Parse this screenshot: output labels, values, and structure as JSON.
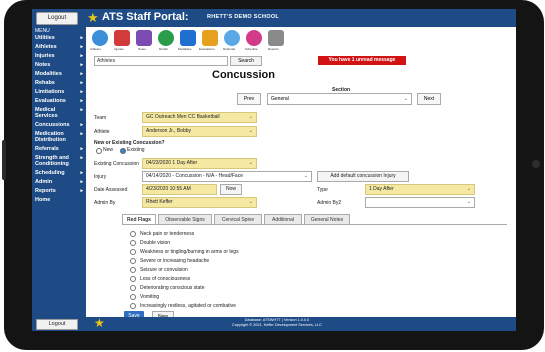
{
  "header": {
    "logout_label": "Logout",
    "portal_title": "ATS Staff Portal:",
    "school_name": "RHETT'S DEMO SCHOOL"
  },
  "sidebar": {
    "menu_heading": "MENU",
    "items": [
      {
        "label": "Utilities"
      },
      {
        "label": "Athletes"
      },
      {
        "label": "Injuries"
      },
      {
        "label": "Notes"
      },
      {
        "label": "Modalities"
      },
      {
        "label": "Rehabs"
      },
      {
        "label": "Limitations"
      },
      {
        "label": "Evaluations"
      },
      {
        "label": "Medical\nServices"
      },
      {
        "label": "Concussions"
      },
      {
        "label": "Medication\nDistribution"
      },
      {
        "label": "Referrals"
      },
      {
        "label": "Strength and\nConditioning"
      },
      {
        "label": "Scheduling"
      },
      {
        "label": "Admin"
      },
      {
        "label": "Reports"
      },
      {
        "label": "Home"
      }
    ]
  },
  "filter": {
    "athletes_select": "Athletes",
    "search_label": "Search",
    "unread_message": "You have 1 unread message"
  },
  "page": {
    "title": "Concussion",
    "section_label": "Section",
    "prev_label": "Prev",
    "section_value": "General",
    "next_label": "Next"
  },
  "form": {
    "team_label": "Team",
    "team_value": "GC Outreach Men CC Basketball",
    "athlete_label": "Athlete",
    "athlete_value": "Anderson Jr., Bobby",
    "new_existing_label": "New or Existing Concussion?",
    "new_option": "New",
    "existing_option": "Existing",
    "existing_concussion_label": "Existing Concussion",
    "existing_concussion_value": "04/23/2020 1 Day After",
    "injury_label": "Injury",
    "injury_value": "04/14/2020 - Concussion - N/A - Head/Face",
    "add_default_label": "Add default concussion Injury",
    "date_assessed_label": "Date Assessed",
    "date_assessed_value": "4/23/2020 10:55 AM",
    "now_label": "Now",
    "type_label": "Type",
    "type_value": "1 Day After",
    "admin_by_label": "Admin By",
    "admin_by_value": "Rhett Keffer",
    "admin_by2_label": "Admin By2",
    "admin_by2_value": ""
  },
  "tabs": [
    {
      "label": "Red Flags"
    },
    {
      "label": "Observable Signs"
    },
    {
      "label": "Cervical Spine"
    },
    {
      "label": "Additional"
    },
    {
      "label": "General Notes"
    }
  ],
  "red_flags": [
    "Neck pain or tenderness",
    "Double vision",
    "Weakness or tingling/burning in arms or legs",
    "Severe or increasing headache",
    "Seizure or convulsion",
    "Loss of consciousness",
    "Deteriorating conscious state",
    "Vomiting",
    "Increasingly restless, agitated or combative"
  ],
  "actions": {
    "save_label": "Save",
    "new_label": "New"
  },
  "footer": {
    "logout_label": "Logout",
    "line1": "Database: ATSWHTT | Version 1.0.0.0",
    "line2": "Copyright © 2021, Keffer Development Services, LLC"
  },
  "colors": {
    "nav_blue": "#1e4b86",
    "highlight_yellow": "#f5e8a3",
    "alert_red": "#d11313",
    "save_blue": "#2f6fbf"
  },
  "toolbar_icons": [
    {
      "name": "athletes-icon",
      "label": "Athletes",
      "color": "#3b8ed8"
    },
    {
      "name": "injuries-icon",
      "label": "Injuries",
      "color": "#d13b3b"
    },
    {
      "name": "notes-icon",
      "label": "Notes",
      "color": "#7b4bb3"
    },
    {
      "name": "rehab-icon",
      "label": "Rehab",
      "color": "#2a9d4a"
    },
    {
      "name": "modalities-icon",
      "label": "Modalities",
      "color": "#1f6fd1"
    },
    {
      "name": "evaluations-icon",
      "label": "Evaluations",
      "color": "#e5a01e"
    },
    {
      "name": "referrals-icon",
      "label": "Referrals",
      "color": "#5aa9e6"
    },
    {
      "name": "schedule-icon",
      "label": "Schedule",
      "color": "#d13b8a"
    },
    {
      "name": "reports-icon",
      "label": "Reports",
      "color": "#8a8a8a"
    }
  ]
}
